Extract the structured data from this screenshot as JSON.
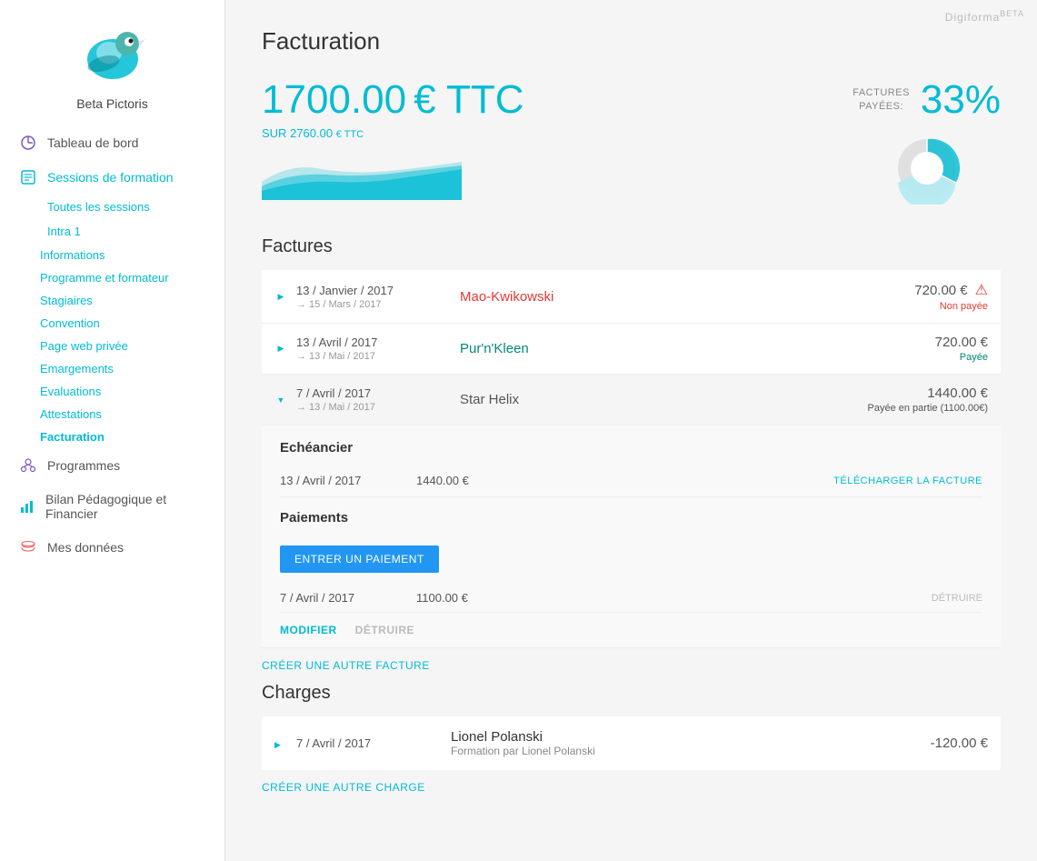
{
  "app": {
    "brand": "Digiforma",
    "beta": "BETA"
  },
  "sidebar": {
    "org_name": "Beta Pictoris",
    "nav_items": [
      {
        "id": "tableau-de-bord",
        "label": "Tableau de bord",
        "icon": "dashboard-icon",
        "active": false
      },
      {
        "id": "sessions-de-formation",
        "label": "Sessions de formation",
        "icon": "sessions-icon",
        "active": true
      }
    ],
    "sessions_sub": [
      {
        "id": "toutes-les-sessions",
        "label": "Toutes les sessions"
      },
      {
        "id": "intra-1",
        "label": "Intra 1"
      }
    ],
    "intra_sub": [
      {
        "id": "informations",
        "label": "Informations"
      },
      {
        "id": "programme-et-formateur",
        "label": "Programme et formateur"
      },
      {
        "id": "stagiaires",
        "label": "Stagiaires"
      },
      {
        "id": "convention",
        "label": "Convention"
      },
      {
        "id": "page-web-privee",
        "label": "Page web privée"
      },
      {
        "id": "emargements",
        "label": "Emargements"
      },
      {
        "id": "evaluations",
        "label": "Evaluations"
      },
      {
        "id": "attestations",
        "label": "Attestations"
      },
      {
        "id": "facturation",
        "label": "Facturation",
        "active": true
      }
    ],
    "other_items": [
      {
        "id": "programmes",
        "label": "Programmes",
        "icon": "programmes-icon"
      },
      {
        "id": "bilan-pedagogique",
        "label": "Bilan Pédagogique et Financier",
        "icon": "bilan-icon"
      },
      {
        "id": "mes-donnees",
        "label": "Mes données",
        "icon": "donnees-icon"
      }
    ]
  },
  "main": {
    "page_title": "Facturation",
    "stats": {
      "paid_amount": "1700.00",
      "paid_currency": "€ TTC",
      "total_label": "SUR 2760.00",
      "total_currency": "€ TTC",
      "percent_label_line1": "FACTURES",
      "percent_label_line2": "PAYÉES:",
      "percent_value": "33%",
      "pie_paid": 33,
      "pie_unpaid": 67
    },
    "factures_section": {
      "title": "Factures",
      "items": [
        {
          "id": "facture-1",
          "date_main": "13 / Janvier / 2017",
          "date_sub": "→ 15 / Mars / 2017",
          "client": "Mao-Kwikowski",
          "client_color": "red",
          "amount": "720.00 €",
          "status": "Non payée",
          "status_type": "non-payee",
          "has_warning": true,
          "expanded": false
        },
        {
          "id": "facture-2",
          "date_main": "13 / Avril / 2017",
          "date_sub": "→ 13 / Mai / 2017",
          "client": "Pur'n'Kleen",
          "client_color": "teal",
          "amount": "720.00 €",
          "status": "Payée",
          "status_type": "payee",
          "has_warning": false,
          "expanded": false
        },
        {
          "id": "facture-3",
          "date_main": "7 / Avril / 2017",
          "date_sub": "→ 13 / Mai / 2017",
          "client": "Star Helix",
          "client_color": "default",
          "amount": "1440.00 €",
          "status": "Payée en partie (1100.00€)",
          "status_type": "partiel",
          "has_warning": false,
          "expanded": true,
          "echeancier": {
            "title": "Echéancier",
            "rows": [
              {
                "date": "13 / Avril / 2017",
                "amount": "1440.00 €",
                "action": "TÉLÉCHARGER LA FACTURE"
              }
            ]
          },
          "paiements": {
            "title": "Paiements",
            "btn_label": "ENTRER UN PAIEMENT",
            "rows": [
              {
                "date": "7 / Avril / 2017",
                "amount": "1100.00 €",
                "action": "DÉTRUIRE"
              }
            ]
          },
          "actions": {
            "modifier": "MODIFIER",
            "detruire": "DÉTRUIRE"
          }
        }
      ],
      "create_link": "CRÉER UNE AUTRE FACTURE"
    },
    "charges_section": {
      "title": "Charges",
      "items": [
        {
          "id": "charge-1",
          "date": "7 / Avril / 2017",
          "client_name": "Lionel Polanski",
          "client_sub": "Formation par Lionel Polanski",
          "amount": "-120.00 €"
        }
      ],
      "create_link": "CRÉER UNE AUTRE CHARGE"
    }
  }
}
